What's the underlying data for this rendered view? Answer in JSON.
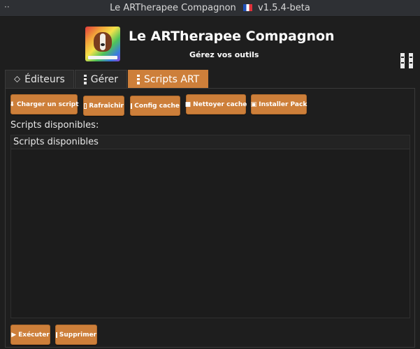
{
  "window": {
    "title": "Le ARTherapee Compagnon",
    "version": "v1.5.4-beta",
    "menu_glyph": "··"
  },
  "header": {
    "app_title": "Le ARTherapee Compagnon",
    "subtitle": "Gérez vos outils"
  },
  "tabs": [
    {
      "label": "Éditeurs",
      "icon": "tag-icon",
      "active": false
    },
    {
      "label": "Gérer",
      "icon": "tool-icon",
      "active": false
    },
    {
      "label": "Scripts ART",
      "icon": "script-icon",
      "active": true
    }
  ],
  "toolbar": {
    "load_label": "Charger un script",
    "refresh_label": "Rafraîchir",
    "config_label": "Config cache",
    "clean_label": "Nettoyer cache",
    "install_label": "Installer Pack"
  },
  "scripts": {
    "section_label": "Scripts disponibles:",
    "column_header": "Scripts disponibles",
    "items": []
  },
  "actions": {
    "run_label": "Exécuter",
    "delete_label": "Supprimer"
  },
  "colors": {
    "accent": "#cd7f3a",
    "background": "#1e1e1e",
    "titlebar": "#2e3034"
  }
}
